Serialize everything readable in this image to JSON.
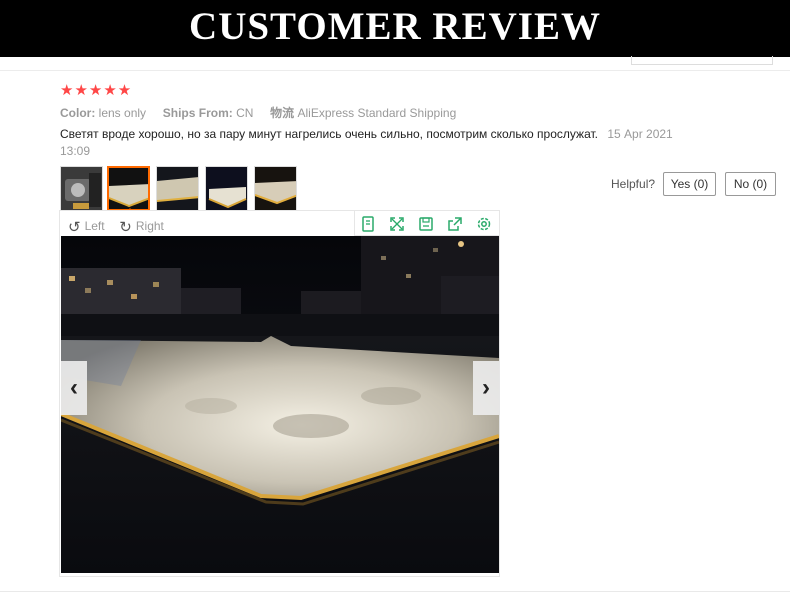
{
  "banner": {
    "title": "CUSTOMER  REVIEW"
  },
  "review": {
    "rating_stars": "★★★★★",
    "color_label": "Color:",
    "color_value": "lens only",
    "ships_label": "Ships From:",
    "ships_value": "CN",
    "shipping_label": "物流",
    "shipping_value": "AliExpress Standard Shipping",
    "text": "Светят вроде хорошо, но за пару минут нагрелись очень сильно, посмотрим сколько прослужат.",
    "date": "15 Apr 2021 13:09"
  },
  "feedback": {
    "helpful_label": "Helpful?",
    "yes_label": "Yes (0)",
    "no_label": "No (0)"
  },
  "viewer": {
    "rotate_left_label": "Left",
    "rotate_right_label": "Right",
    "prev_arrow": "‹",
    "next_arrow": "›",
    "selected_thumbnail": 2,
    "thumbnail_count": 5
  },
  "colors": {
    "star": "#ff4747",
    "selected_border": "#ff6a00",
    "tool_icons": "#2aaa6a"
  }
}
